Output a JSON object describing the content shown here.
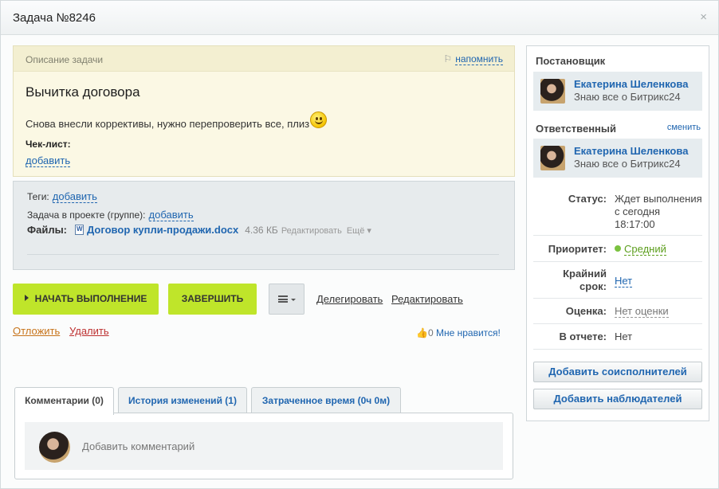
{
  "window": {
    "title": "Задача №8246",
    "close": "×"
  },
  "description": {
    "header": "Описание задачи",
    "remind": "напомнить",
    "title": "Вычитка договора",
    "text": "Снова внесли коррективы, нужно перепроверить все, плиз",
    "checklist_label": "Чек-лист:",
    "checklist_add": "добавить"
  },
  "meta": {
    "tags_label": "Теги:",
    "tags_add": "добавить",
    "project_label": "Задача в проекте (группе):",
    "project_add": "добавить",
    "files_label": "Файлы:",
    "file": {
      "name": "Договор купли-продажи.docx",
      "size": "4.36 КБ",
      "edit": "Редактировать",
      "more": "Ещё ▾"
    }
  },
  "actions": {
    "start": "НАЧАТЬ ВЫПОЛНЕНИЕ",
    "finish": "ЗАВЕРШИТЬ",
    "delegate": "Делегировать",
    "edit": "Редактировать",
    "postpone": "Отложить",
    "delete": "Удалить",
    "like_count": "0",
    "like_label": "Мне нравится!"
  },
  "tabs": [
    {
      "label": "Комментарии (0)"
    },
    {
      "label": "История изменений (1)"
    },
    {
      "label": "Затраченное время (0ч 0м)"
    }
  ],
  "comments": {
    "placeholder": "Добавить комментарий"
  },
  "sidebar": {
    "creator_label": "Постановщик",
    "creator": {
      "name": "Екатерина Шеленкова",
      "role": "Знаю все о Битрикс24"
    },
    "responsible_label": "Ответственный",
    "change": "сменить",
    "responsible": {
      "name": "Екатерина Шеленкова",
      "role": "Знаю все о Битрикс24"
    },
    "status_label": "Статус:",
    "status_line1": "Ждет выполнения",
    "status_line2": "с сегодня",
    "status_line3": "18:17:00",
    "priority_label": "Приоритет:",
    "priority_value": "Средний",
    "deadline_label_1": "Крайний",
    "deadline_label_2": "срок:",
    "deadline_value": "Нет",
    "rating_label": "Оценка:",
    "rating_value": "Нет оценки",
    "report_label": "В отчете:",
    "report_value": "Нет",
    "add_coexecutors": "Добавить соисполнителей",
    "add_observers": "Добавить наблюдателей",
    "priority_color": "#7bc240"
  }
}
